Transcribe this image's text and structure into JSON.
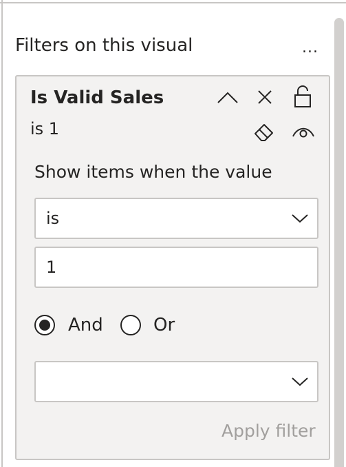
{
  "pane": {
    "section_title": "Filters on this visual",
    "more_options_icon": "ellipsis-icon",
    "more_options_glyph": "..."
  },
  "filter_card": {
    "field_name": "Is Valid Sales",
    "summary": "is 1",
    "icons": [
      "collapse-chevron-up-icon",
      "close-icon",
      "lock-icon",
      "eraser-icon",
      "eye-icon"
    ],
    "show_items_label": "Show items when the value",
    "condition1": {
      "operator": "is",
      "value": "1"
    },
    "logic": {
      "and_label": "And",
      "or_label": "Or",
      "selected": "And"
    },
    "condition2": {
      "operator": "",
      "value": ""
    },
    "apply_label": "Apply filter"
  },
  "colors": {
    "text": "#252423",
    "card_bg": "#f3f2f1",
    "border": "#c8c6c4",
    "disabled_text": "#a19f9d"
  }
}
